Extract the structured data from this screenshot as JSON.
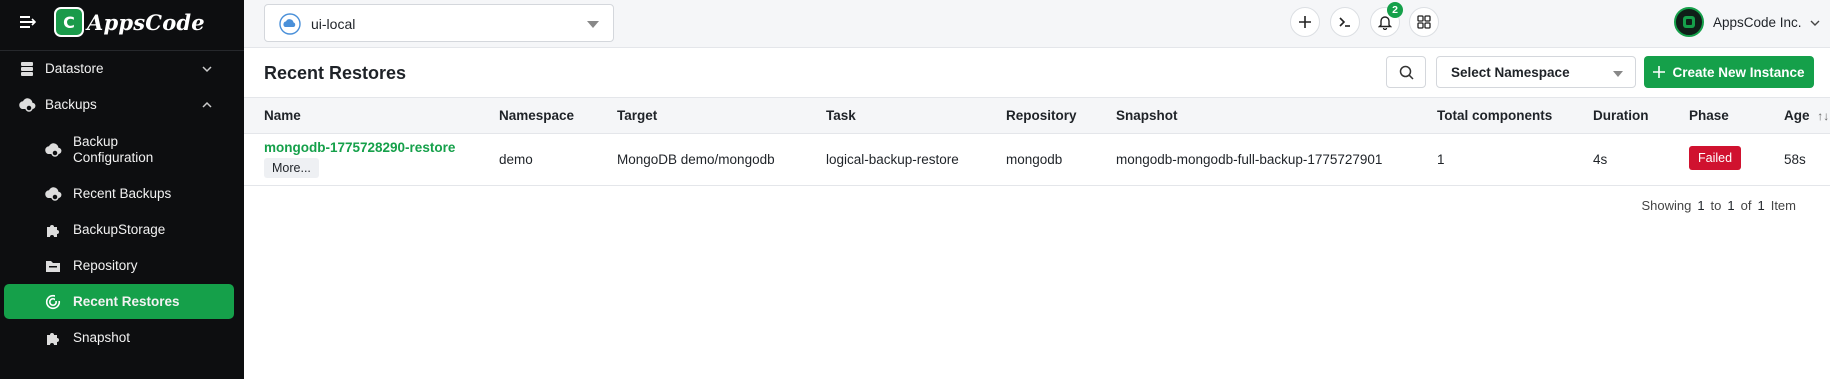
{
  "brand": {
    "logo_text": "AppsCode"
  },
  "sidebar": {
    "items": [
      {
        "label": "Datastore",
        "icon": "database-icon"
      },
      {
        "label": "Backups",
        "icon": "cloud-gear-icon"
      },
      {
        "label": "Backup Configuration",
        "icon": "cloud-gear-icon"
      },
      {
        "label": "Recent Backups",
        "icon": "cloud-gear-icon"
      },
      {
        "label": "BackupStorage",
        "icon": "puzzle-icon"
      },
      {
        "label": "Repository",
        "icon": "folder-icon"
      },
      {
        "label": "Recent Restores",
        "icon": "restore-icon",
        "active": true
      },
      {
        "label": "Snapshot",
        "icon": "puzzle-icon"
      }
    ]
  },
  "topbar": {
    "cluster": "ui-local",
    "notifications_count": "2",
    "org_name": "AppsCode Inc."
  },
  "page": {
    "title": "Recent Restores",
    "namespace_placeholder": "Select Namespace",
    "create_label": "Create New Instance"
  },
  "table": {
    "columns": [
      "Name",
      "Namespace",
      "Target",
      "Task",
      "Repository",
      "Snapshot",
      "Total components",
      "Duration",
      "Phase",
      "Age"
    ],
    "sort_indicator": "↑↓",
    "rows": [
      {
        "name": "mongodb-1775728290-restore",
        "more": "More...",
        "namespace": "demo",
        "target": "MongoDB demo/mongodb",
        "task": "logical-backup-restore",
        "repository": "mongodb",
        "snapshot": "mongodb-mongodb-full-backup-1775727901",
        "total_components": "1",
        "duration": "4s",
        "phase": "Failed",
        "age": "58s"
      }
    ],
    "pagination": {
      "showing": "Showing",
      "from": "1",
      "to_word": "to",
      "to": "1",
      "of_word": "of",
      "total": "1",
      "item_word": "Item"
    }
  },
  "colors": {
    "accent": "#15a04a",
    "danger": "#d0122f",
    "sidebar_bg": "#0d0e10"
  }
}
